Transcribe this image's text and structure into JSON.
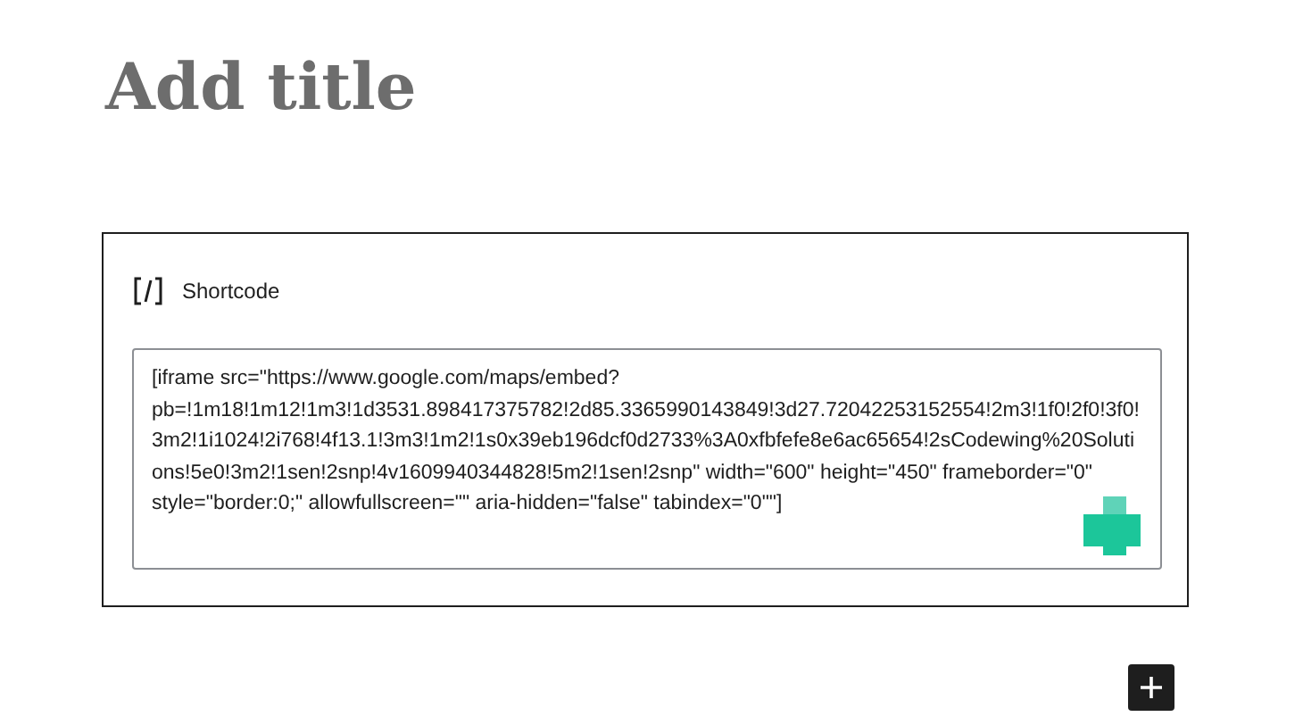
{
  "title": {
    "placeholder": "Add title"
  },
  "block": {
    "label": "Shortcode",
    "value": "[iframe src=\"https://www.google.com/maps/embed?pb=!1m18!1m12!1m3!1d3531.898417375782!2d85.3365990143849!3d27.72042253152554!2m3!1f0!2f0!3f0!3m2!1i1024!2i768!4f13.1!3m3!1m2!1s0x39eb196dcf0d2733%3A0xfbfefe8e6ac65654!2sCodewing%20Solutions!5e0!3m2!1sen!2snp!4v1609940344828!5m2!1sen!2snp\" width=\"600\" height=\"450\" frameborder=\"0\" style=\"border:0;\" allowfullscreen=\"\" aria-hidden=\"false\" tabindex=\"0\"\"]"
  }
}
